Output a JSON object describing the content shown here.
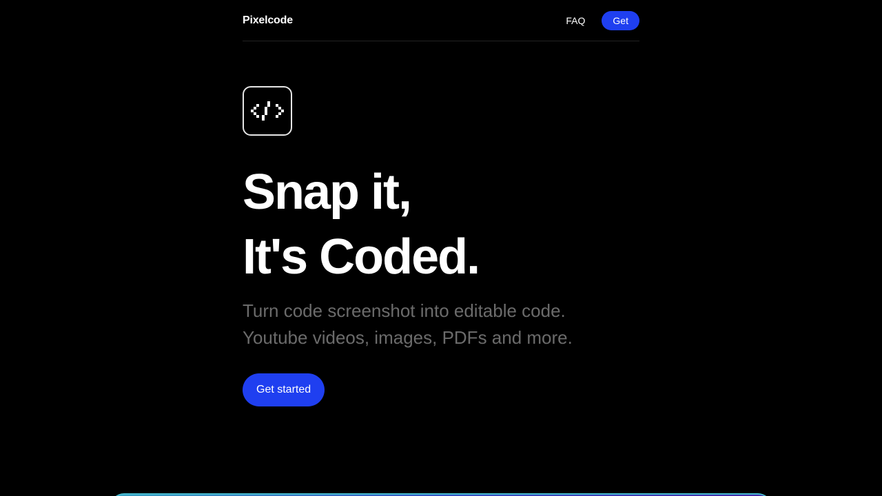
{
  "header": {
    "brand": "Pixelcode",
    "faq_label": "FAQ",
    "get_label": "Get"
  },
  "hero": {
    "logo_icon": "code-brackets-icon",
    "headline_line1": "Snap it,",
    "headline_line2": "It's Coded.",
    "subtitle_line1": "Turn code screenshot into editable code.",
    "subtitle_line2": "Youtube videos, images, PDFs and more.",
    "cta_label": "Get started"
  },
  "colors": {
    "background": "#000000",
    "accent": "#1f3ff0",
    "subtitle": "#6b6b6b"
  }
}
